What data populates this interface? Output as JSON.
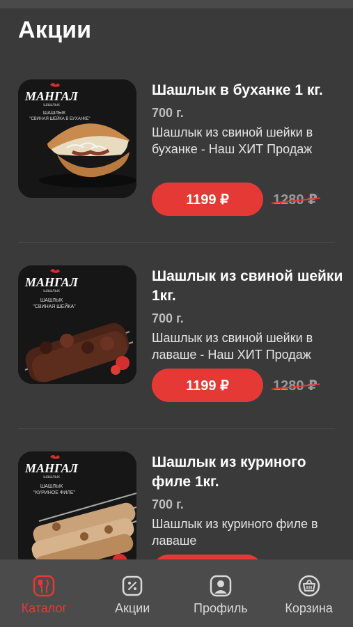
{
  "header": {
    "title": "Акции"
  },
  "products": [
    {
      "name": "Шашлык в буханке 1 кг.",
      "weight": "700 г.",
      "description": "Шашлык из свиной шейки в буханке - Наш ХИТ Продаж",
      "price": "1199 ₽",
      "old_price": "1280 ₽",
      "image": {
        "logo": "МАНГАЛ",
        "logo_sub": "шашлык",
        "caption_1": "ШАШЛЫК",
        "caption_2": "\"СВИНАЯ ШЕЙКА В БУХАНКЕ\""
      }
    },
    {
      "name": "Шашлык из свиной шейки 1кг.",
      "weight": "700 г.",
      "description": "Шашлык из свиной шейки в лаваше - Наш ХИТ Продаж",
      "price": "1199 ₽",
      "old_price": "1280 ₽",
      "image": {
        "logo": "МАНГАЛ",
        "logo_sub": "шашлык",
        "caption_1": "ШАШЛЫК",
        "caption_2": "\"СВИНАЯ ШЕЙКА\""
      }
    },
    {
      "name": "Шашлык из куриного филе 1кг.",
      "weight": "700 г.",
      "description": "Шашлык из куриного филе в лаваше",
      "price": "",
      "old_price": "",
      "image": {
        "logo": "МАНГАЛ",
        "logo_sub": "шашлык",
        "caption_1": "ШАШЛЫК",
        "caption_2": "\"КУРИНОЕ ФИЛЕ\""
      }
    }
  ],
  "bottom_nav": [
    {
      "label": "Каталог",
      "icon": "catalog-icon",
      "active": true
    },
    {
      "label": "Акции",
      "icon": "promo-icon",
      "active": false
    },
    {
      "label": "Профиль",
      "icon": "profile-icon",
      "active": false
    },
    {
      "label": "Корзина",
      "icon": "basket-icon",
      "active": false
    }
  ],
  "colors": {
    "accent": "#e53935",
    "background": "#3a3a3a",
    "nav_background": "#4b4b4b"
  }
}
